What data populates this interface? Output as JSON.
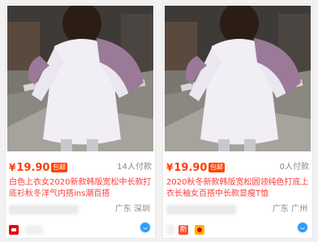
{
  "listings": [
    {
      "currency_symbol": "¥",
      "price": "19.90",
      "badge": "包邮",
      "sold": "14人付款",
      "title": "白色上衣女2020新款韩版宽松中长款打底衫秋冬洋气内搭ins潮百搭",
      "location": "广东 深圳",
      "image_icon": "product-photo-white-top-purple-sweater"
    },
    {
      "currency_symbol": "¥",
      "price": "19.90",
      "badge": "包邮",
      "sold": "0人付款",
      "title": "2020秋冬新款韩版宽松圆领纯色打底上衣长袖女百搭中长款显瘦T恤",
      "location": "广东 广州",
      "image_icon": "product-photo-white-top-purple-sweater",
      "store_badge_text": "新"
    }
  ],
  "colors": {
    "price": "#ff3d00",
    "title": "#ff3a3a",
    "badge_bg": "#ff4400",
    "muted": "#888888"
  }
}
